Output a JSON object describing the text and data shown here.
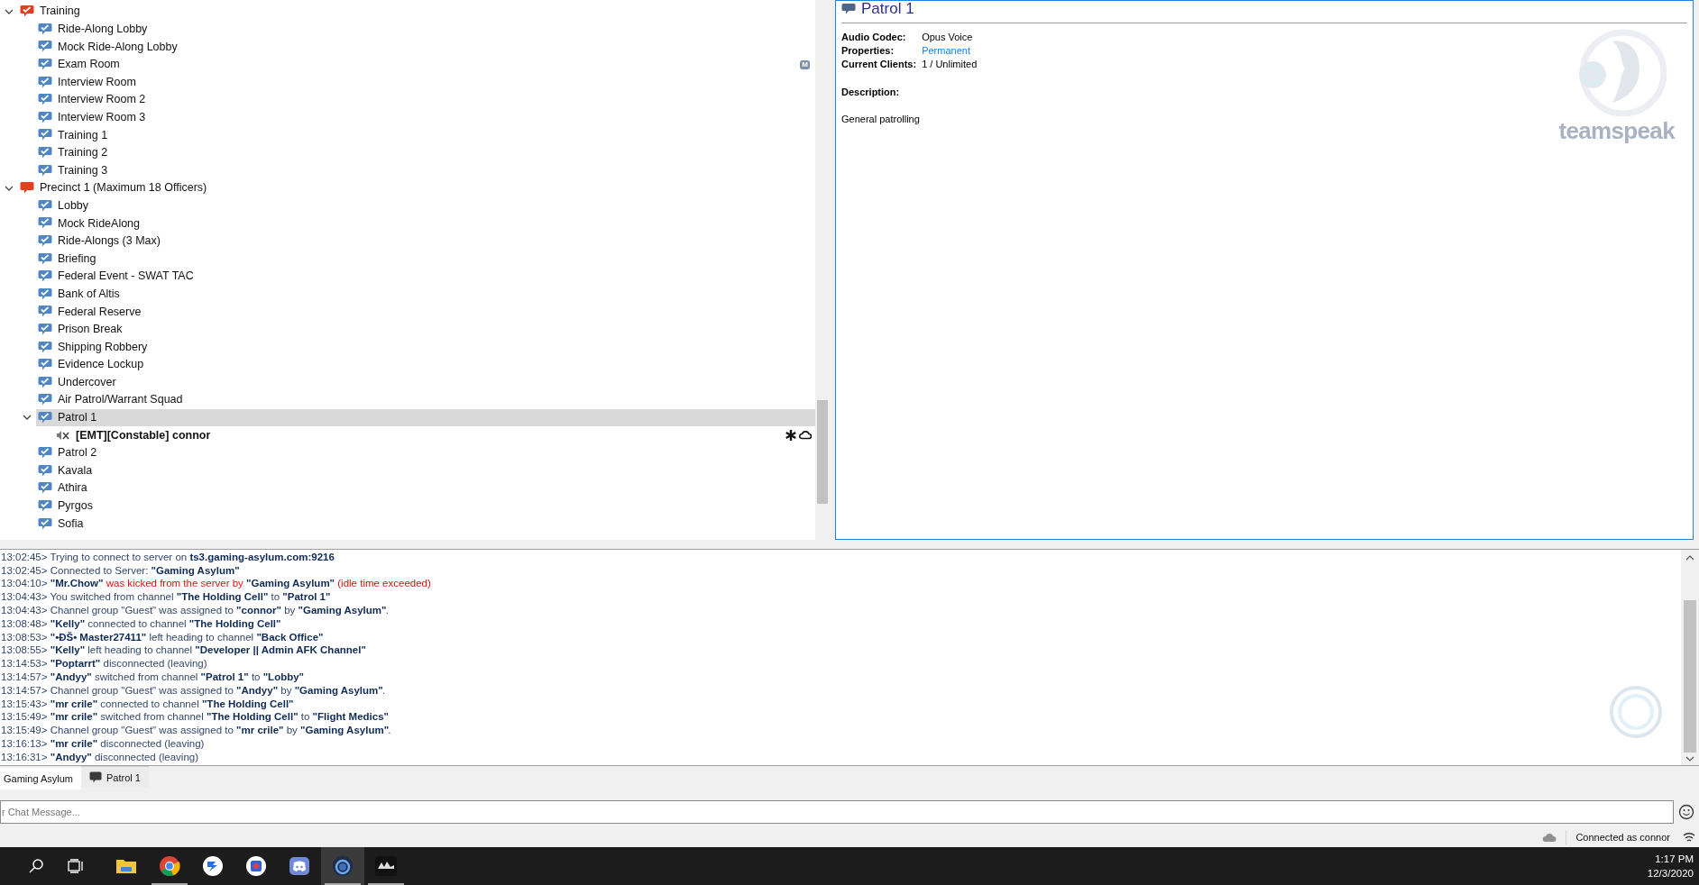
{
  "tree": [
    {
      "label": "Training",
      "kind": "category",
      "expanded": true,
      "selected": false,
      "children": [
        {
          "label": "Ride-Along Lobby",
          "kind": "channel",
          "selected": false
        },
        {
          "label": "Mock Ride-Along Lobby",
          "kind": "channel",
          "selected": false
        },
        {
          "label": "Exam Room",
          "kind": "channel",
          "selected": false,
          "badge": "M"
        },
        {
          "label": "Interview Room",
          "kind": "channel",
          "selected": false
        },
        {
          "label": "Interview Room 2",
          "kind": "channel",
          "selected": false
        },
        {
          "label": "Interview Room 3",
          "kind": "channel",
          "selected": false
        },
        {
          "label": "Training 1",
          "kind": "channel",
          "selected": false
        },
        {
          "label": "Training 2",
          "kind": "channel",
          "selected": false
        },
        {
          "label": "Training 3",
          "kind": "channel",
          "selected": false
        }
      ]
    },
    {
      "label": "Precinct 1 (Maximum 18 Officers)",
      "kind": "category_full",
      "expanded": true,
      "selected": false,
      "children": [
        {
          "label": "Lobby",
          "kind": "channel",
          "selected": false
        },
        {
          "label": "Mock RideAlong",
          "kind": "channel",
          "selected": false
        },
        {
          "label": "Ride-Alongs (3 Max)",
          "kind": "channel",
          "selected": false
        },
        {
          "label": "Briefing",
          "kind": "channel",
          "selected": false
        },
        {
          "label": "Federal Event - SWAT TAC",
          "kind": "channel",
          "selected": false
        },
        {
          "label": "Bank of Altis",
          "kind": "channel",
          "selected": false
        },
        {
          "label": "Federal Reserve",
          "kind": "channel",
          "selected": false
        },
        {
          "label": "Prison Break",
          "kind": "channel",
          "selected": false
        },
        {
          "label": "Shipping Robbery",
          "kind": "channel",
          "selected": false
        },
        {
          "label": "Evidence Lockup",
          "kind": "channel",
          "selected": false
        },
        {
          "label": "Undercover",
          "kind": "channel",
          "selected": false
        },
        {
          "label": "Air Patrol/Warrant Squad",
          "kind": "channel",
          "selected": false
        },
        {
          "label": "Patrol 1",
          "kind": "channel",
          "selected": true,
          "expanded": true,
          "children": [
            {
              "label": "[EMT][Constable] connor",
              "kind": "client",
              "selected": false
            }
          ]
        },
        {
          "label": "Patrol 2",
          "kind": "channel",
          "selected": false
        },
        {
          "label": "Kavala",
          "kind": "channel",
          "selected": false
        },
        {
          "label": "Athira",
          "kind": "channel",
          "selected": false
        },
        {
          "label": "Pyrgos",
          "kind": "channel",
          "selected": false
        },
        {
          "label": "Sofia",
          "kind": "channel",
          "selected": false
        }
      ]
    }
  ],
  "info": {
    "title": "Patrol 1",
    "fields": [
      {
        "label": "Audio Codec:",
        "value": "Opus Voice",
        "kind": "text"
      },
      {
        "label": "Properties:",
        "value": "Permanent",
        "kind": "link"
      },
      {
        "label": "Current Clients:",
        "value": "1 / Unlimited",
        "kind": "text"
      }
    ],
    "description_label": "Description:",
    "description": "General patrolling",
    "logo_text": "teamspeak"
  },
  "log": [
    {
      "time": "13:02:45>",
      "parts": [
        {
          "text": "Trying to connect to server on",
          "kind": "plain"
        },
        {
          "text": "ts3.gaming-asylum.com:9216",
          "kind": "bold"
        }
      ]
    },
    {
      "time": "13:02:45>",
      "parts": [
        {
          "text": "Connected to Server:",
          "kind": "plain"
        },
        {
          "text": "\"Gaming Asylum\"",
          "kind": "bold"
        }
      ]
    },
    {
      "time": "13:04:10>",
      "parts": [
        {
          "text": "\"Mr.Chow\"",
          "kind": "bold"
        },
        {
          "text": "was kicked from the server by",
          "kind": "error"
        },
        {
          "text": "\"Gaming Asylum\"",
          "kind": "bold"
        },
        {
          "text": "(idle time exceeded)",
          "kind": "error"
        }
      ]
    },
    {
      "time": "13:04:43>",
      "parts": [
        {
          "text": "You switched from channel",
          "kind": "plain"
        },
        {
          "text": "\"The Holding Cell\"",
          "kind": "bold"
        },
        {
          "text": "to",
          "kind": "plain"
        },
        {
          "text": "\"Patrol 1\"",
          "kind": "bold"
        }
      ]
    },
    {
      "time": "13:04:43>",
      "parts": [
        {
          "text": "Channel group \"Guest\" was assigned to",
          "kind": "plain"
        },
        {
          "text": "\"connor\"",
          "kind": "bold"
        },
        {
          "text": "by",
          "kind": "plain"
        },
        {
          "text": "\"Gaming Asylum\"",
          "kind": "bold"
        },
        {
          "text": ".",
          "kind": "tight"
        }
      ]
    },
    {
      "time": "13:08:48>",
      "parts": [
        {
          "text": "\"Kelly\"",
          "kind": "bold"
        },
        {
          "text": "connected to channel",
          "kind": "plain"
        },
        {
          "text": "\"The Holding Cell\"",
          "kind": "bold"
        }
      ]
    },
    {
      "time": "13:08:53>",
      "parts": [
        {
          "text": "\"•ĐŠ• Master27411\"",
          "kind": "bold"
        },
        {
          "text": "left heading to channel",
          "kind": "plain"
        },
        {
          "text": "\"Back Office\"",
          "kind": "bold"
        }
      ]
    },
    {
      "time": "13:08:55>",
      "parts": [
        {
          "text": "\"Kelly\"",
          "kind": "bold"
        },
        {
          "text": "left heading to channel",
          "kind": "plain"
        },
        {
          "text": "\"Developer || Admin AFK Channel\"",
          "kind": "bold"
        }
      ]
    },
    {
      "time": "13:14:53>",
      "parts": [
        {
          "text": "\"Poptarrt\"",
          "kind": "bold"
        },
        {
          "text": "disconnected (leaving)",
          "kind": "plain"
        }
      ]
    },
    {
      "time": "13:14:57>",
      "parts": [
        {
          "text": "\"Andyy\"",
          "kind": "bold"
        },
        {
          "text": "switched from channel",
          "kind": "plain"
        },
        {
          "text": "\"Patrol 1\"",
          "kind": "bold"
        },
        {
          "text": "to",
          "kind": "plain"
        },
        {
          "text": "\"Lobby\"",
          "kind": "bold"
        }
      ]
    },
    {
      "time": "13:14:57>",
      "parts": [
        {
          "text": "Channel group \"Guest\" was assigned to",
          "kind": "plain"
        },
        {
          "text": "\"Andyy\"",
          "kind": "bold"
        },
        {
          "text": "by",
          "kind": "plain"
        },
        {
          "text": "\"Gaming Asylum\"",
          "kind": "bold"
        },
        {
          "text": ".",
          "kind": "tight"
        }
      ]
    },
    {
      "time": "13:15:43>",
      "parts": [
        {
          "text": "\"mr crile\"",
          "kind": "bold"
        },
        {
          "text": "connected to channel",
          "kind": "plain"
        },
        {
          "text": "\"The Holding Cell\"",
          "kind": "bold"
        }
      ]
    },
    {
      "time": "13:15:49>",
      "parts": [
        {
          "text": "\"mr crile\"",
          "kind": "bold"
        },
        {
          "text": "switched from channel",
          "kind": "plain"
        },
        {
          "text": "\"The Holding Cell\"",
          "kind": "bold"
        },
        {
          "text": "to",
          "kind": "plain"
        },
        {
          "text": "\"Flight Medics\"",
          "kind": "bold"
        }
      ]
    },
    {
      "time": "13:15:49>",
      "parts": [
        {
          "text": "Channel group \"Guest\" was assigned to",
          "kind": "plain"
        },
        {
          "text": "\"mr crile\"",
          "kind": "bold"
        },
        {
          "text": "by",
          "kind": "plain"
        },
        {
          "text": "\"Gaming Asylum\"",
          "kind": "bold"
        },
        {
          "text": ".",
          "kind": "tight"
        }
      ]
    },
    {
      "time": "13:16:13>",
      "parts": [
        {
          "text": "\"mr crile\"",
          "kind": "bold"
        },
        {
          "text": "disconnected (leaving)",
          "kind": "plain"
        }
      ]
    },
    {
      "time": "13:16:31>",
      "parts": [
        {
          "text": "\"Andyy\"",
          "kind": "bold"
        },
        {
          "text": "disconnected (leaving)",
          "kind": "plain"
        }
      ]
    }
  ],
  "chat_tabs": [
    {
      "label": "Gaming Asylum",
      "kind": "server",
      "selected": true
    },
    {
      "label": "Patrol 1",
      "kind": "channel",
      "selected": false
    }
  ],
  "chat_input": {
    "placeholder": "r Chat Message..."
  },
  "status": {
    "text": "Connected as connor"
  },
  "taskbar": {
    "apps": [
      {
        "kind": "explorer",
        "running": false,
        "selected": false
      },
      {
        "kind": "chrome",
        "running": true,
        "selected": false
      },
      {
        "kind": "blue",
        "running": false,
        "selected": false
      },
      {
        "kind": "diamond",
        "running": false,
        "selected": false
      },
      {
        "kind": "discord",
        "running": false,
        "selected": false
      },
      {
        "kind": "teamspeak",
        "running": true,
        "selected": true
      },
      {
        "kind": "arma",
        "running": true,
        "selected": false
      }
    ],
    "time": "1:17 PM",
    "date": "12/3/2020"
  }
}
